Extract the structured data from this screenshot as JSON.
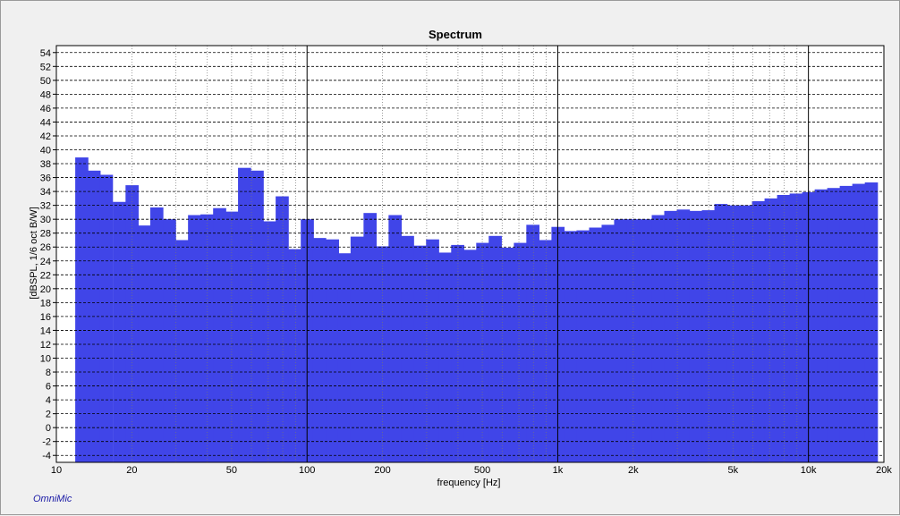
{
  "app": {
    "watermark": "OmniMic"
  },
  "colors": {
    "bars": "#4045e8",
    "plot_bg": "#ffffff",
    "grid": "#000000",
    "window_bg": "#f0f0f0"
  },
  "chart_data": {
    "type": "bar",
    "title": "Spectrum",
    "xlabel": "frequency [Hz]",
    "ylabel": "[dBSPL, 1/6 oct B/W]",
    "xscale": "log",
    "xlim": [
      10,
      20000
    ],
    "ylim": [
      -5,
      55
    ],
    "yticks": [
      -4,
      -2,
      0,
      2,
      4,
      6,
      8,
      10,
      12,
      14,
      16,
      18,
      20,
      22,
      24,
      26,
      28,
      30,
      32,
      34,
      36,
      38,
      40,
      42,
      44,
      46,
      48,
      50,
      52,
      54
    ],
    "xticks": [
      {
        "value": 10,
        "label": "10"
      },
      {
        "value": 20,
        "label": "20"
      },
      {
        "value": 50,
        "label": "50"
      },
      {
        "value": 100,
        "label": "100"
      },
      {
        "value": 200,
        "label": "200"
      },
      {
        "value": 500,
        "label": "500"
      },
      {
        "value": 1000,
        "label": "1k"
      },
      {
        "value": 2000,
        "label": "2k"
      },
      {
        "value": 5000,
        "label": "5k"
      },
      {
        "value": 10000,
        "label": "10k"
      },
      {
        "value": 20000,
        "label": "20k"
      }
    ],
    "grid": true,
    "bar_width_oct": 0.1667,
    "x": [
      12.6,
      14.1,
      15.8,
      17.8,
      20.0,
      22.4,
      25.1,
      28.2,
      31.6,
      35.5,
      39.8,
      44.7,
      50.1,
      56.2,
      63.1,
      70.8,
      79.4,
      89.1,
      100,
      112,
      126,
      141,
      158,
      178,
      200,
      224,
      251,
      282,
      316,
      355,
      398,
      447,
      501,
      562,
      631,
      708,
      794,
      891,
      1000,
      1122,
      1259,
      1413,
      1585,
      1778,
      1995,
      2239,
      2512,
      2818,
      3162,
      3548,
      3981,
      4467,
      5012,
      5623,
      6310,
      7079,
      7943,
      8913,
      10000,
      11220,
      12589,
      14125,
      15849,
      17783
    ],
    "values": [
      38.9,
      37.0,
      36.4,
      32.5,
      34.9,
      29.1,
      31.7,
      30.0,
      27.0,
      30.6,
      30.7,
      31.6,
      31.1,
      37.4,
      37.0,
      29.7,
      33.3,
      25.7,
      30.0,
      27.3,
      27.1,
      25.1,
      27.5,
      30.9,
      26.1,
      30.6,
      27.6,
      26.2,
      27.1,
      25.2,
      26.3,
      25.6,
      26.6,
      27.6,
      25.9,
      26.6,
      29.2,
      27.0,
      28.9,
      28.3,
      28.4,
      28.8,
      29.2,
      30.0,
      30.0,
      30.0,
      30.6,
      31.2,
      31.4,
      31.2,
      31.3,
      32.2,
      32.0,
      32.0,
      32.6,
      33.0,
      33.5,
      33.7,
      33.9,
      34.3,
      34.5,
      34.8,
      35.1,
      35.3
    ]
  }
}
